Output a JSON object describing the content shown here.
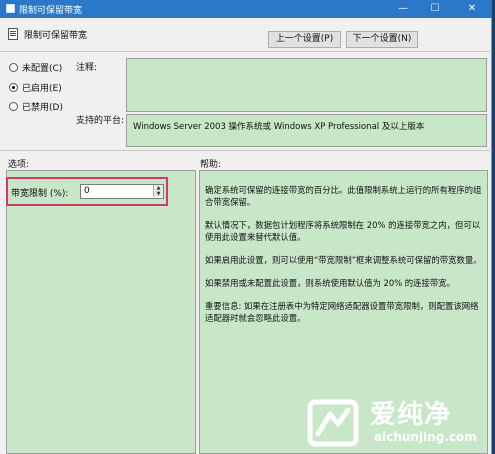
{
  "window": {
    "title": "限制可保留带宽",
    "min_glyph": "—",
    "max_glyph": "☐",
    "close_glyph": "✕"
  },
  "header": {
    "title": "限制可保留带宽"
  },
  "nav": {
    "prev_label": "上一个设置(P)",
    "next_label": "下一个设置(N)"
  },
  "state": {
    "options": [
      {
        "label": "未配置(C)",
        "selected": false
      },
      {
        "label": "已启用(E)",
        "selected": true
      },
      {
        "label": "已禁用(D)",
        "selected": false
      }
    ]
  },
  "comment": {
    "label": "注释:",
    "value": ""
  },
  "platform": {
    "label": "支持的平台:",
    "value": "Windows Server 2003 操作系统或 Windows XP Professional 及以上版本"
  },
  "options_section": {
    "title": "选项:",
    "bandwidth_label": "带宽限制 (%):",
    "bandwidth_value": "0"
  },
  "help_section": {
    "title": "帮助:",
    "paragraphs": [
      "确定系统可保留的连接带宽的百分比。此值限制系统上运行的所有程序的组合带宽保留。",
      "默认情况下，数据包计划程序将系统限制在 20% 的连接带宽之内，但可以使用此设置来替代默认值。",
      "如果启用此设置，则可以使用“带宽限制”框来调整系统可保留的带宽数量。",
      "如果禁用或未配置此设置，则系统使用默认值为 20% 的连接带宽。",
      "重要信息: 如果在注册表中为特定网络适配器设置带宽限制，则配置该网络适配器时就会忽略此设置。"
    ]
  },
  "watermark": {
    "name": "爱纯净",
    "url": "aichunjing.com"
  }
}
